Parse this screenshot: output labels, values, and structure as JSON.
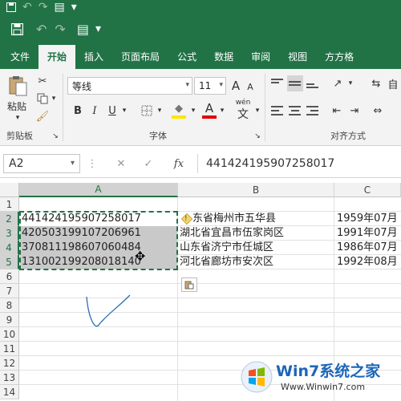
{
  "app": {
    "quick_access": {
      "save": "save-icon",
      "undo": "undo-icon",
      "redo": "redo-icon",
      "form": "form-icon",
      "customize": "▾"
    }
  },
  "ribbon_tabs": [
    "文件",
    "开始",
    "插入",
    "页面布局",
    "公式",
    "数据",
    "审阅",
    "视图",
    "方方格"
  ],
  "ribbon": {
    "paste_label": "粘贴",
    "clipboard_group": "剪贴板",
    "font_name": "等线",
    "font_size": "11",
    "font_group": "字体",
    "wen_label": "wén",
    "wen_char": "文",
    "align_group": "对齐方式",
    "auto_label": "自",
    "buttons": {
      "bold": "B",
      "italic": "I",
      "underline": "U",
      "grow": "A",
      "shrink": "A",
      "font_color": "A",
      "fill": "◆"
    }
  },
  "formula_bar": {
    "name_box": "A2",
    "cancel": "✕",
    "enter": "✓",
    "fx": "fx",
    "content": "441424195907258017"
  },
  "grid": {
    "columns": [
      "A",
      "B",
      "C"
    ],
    "rows": [
      "1",
      "2",
      "3",
      "4",
      "5",
      "6",
      "7",
      "8",
      "9",
      "10",
      "11",
      "12",
      "13",
      "14"
    ],
    "cells": [
      {
        "a": "",
        "b": "",
        "c": ""
      },
      {
        "a": "441424195907258017",
        "b": "东省梅州市五华县",
        "c": "1959年07月"
      },
      {
        "a": "420503199107206961",
        "b": "湖北省宜昌市伍家岗区",
        "c": "1991年07月"
      },
      {
        "a": "370811198607060484",
        "b": "山东省济宁市任城区",
        "c": "1986年07月"
      },
      {
        "a": "131002199208018140",
        "b": "河北省廊坊市安次区",
        "c": "1992年08月"
      }
    ],
    "warning_icon": "◇",
    "paste_options": "paste-options-icon"
  },
  "watermark": {
    "brand": "Win7系统之家",
    "url": "Www.Winwin7.com"
  },
  "colors": {
    "accent": "#217346",
    "selection": "#c9c9c9",
    "ribbon_bg": "#f3f3f3"
  }
}
